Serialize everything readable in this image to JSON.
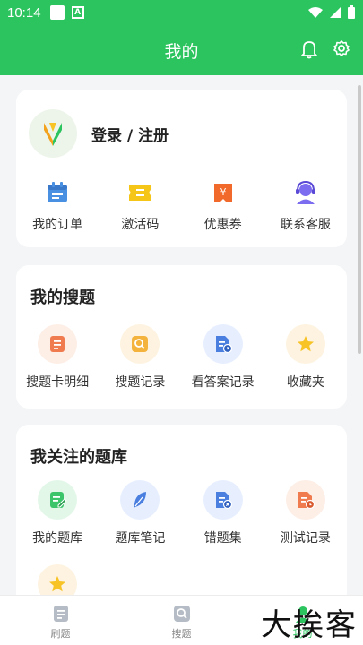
{
  "status_bar": {
    "time": "10:14"
  },
  "header": {
    "title": "我的"
  },
  "account": {
    "login_label": "登录 / 注册",
    "items": [
      {
        "label": "我的订单",
        "icon": "calendar-icon",
        "color": "#4a90e2"
      },
      {
        "label": "激活码",
        "icon": "ticket-icon",
        "color": "#f5c518"
      },
      {
        "label": "优惠券",
        "icon": "coupon-icon",
        "color": "#f26a2b"
      },
      {
        "label": "联系客服",
        "icon": "headset-icon",
        "color": "#7b6cf0"
      }
    ]
  },
  "my_search": {
    "title": "我的搜题",
    "items": [
      {
        "label": "搜题卡明细",
        "icon": "card-detail-icon",
        "color": "#f07b4f",
        "bg": "#fdeee6"
      },
      {
        "label": "搜题记录",
        "icon": "search-record-icon",
        "color": "#f3b33d",
        "bg": "#fdf3e0"
      },
      {
        "label": "看答案记录",
        "icon": "answer-record-icon",
        "color": "#4a7fe0",
        "bg": "#e7efff"
      },
      {
        "label": "收藏夹",
        "icon": "star-icon",
        "color": "#f7c325",
        "bg": "#fdf3e0"
      }
    ]
  },
  "my_banks": {
    "title": "我关注的题库",
    "items": [
      {
        "label": "我的题库",
        "icon": "edit-doc-icon",
        "color": "#3cc46a",
        "bg": "#e3f7e9"
      },
      {
        "label": "题库笔记",
        "icon": "feather-icon",
        "color": "#4a7fe0",
        "bg": "#e7efff"
      },
      {
        "label": "错题集",
        "icon": "wrong-doc-icon",
        "color": "#4a7fe0",
        "bg": "#e7efff"
      },
      {
        "label": "测试记录",
        "icon": "test-doc-icon",
        "color": "#f07b4f",
        "bg": "#fdeee6"
      },
      {
        "label": "",
        "icon": "star-icon",
        "color": "#f7c325",
        "bg": "#fdf3e0"
      }
    ]
  },
  "tabbar": {
    "items": [
      {
        "label": "刷题",
        "icon": "practice-icon"
      },
      {
        "label": "搜题",
        "icon": "search-tab-icon"
      },
      {
        "label": "我的",
        "icon": "profile-icon"
      }
    ],
    "active_index": 2
  },
  "watermark": "大挨客",
  "colors": {
    "brand": "#2cc45f",
    "background": "#f4f5f7"
  }
}
